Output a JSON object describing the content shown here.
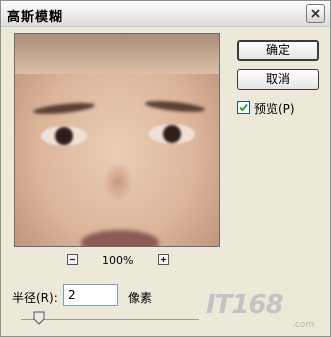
{
  "window": {
    "title": "高斯模糊"
  },
  "buttons": {
    "ok_label": "确定",
    "cancel_label": "取消"
  },
  "preview_toggle": {
    "label": "预览(P)",
    "checked": true
  },
  "zoom": {
    "level": "100%"
  },
  "radius": {
    "label": "半径(R):",
    "value": "2",
    "unit": "像素",
    "slider_fraction": 0.1
  },
  "watermark": {
    "text": "IT168",
    "sub": ".com"
  },
  "colors": {
    "dialog_bg": "#ece9d8",
    "checkbox_mark": "#21a121"
  }
}
